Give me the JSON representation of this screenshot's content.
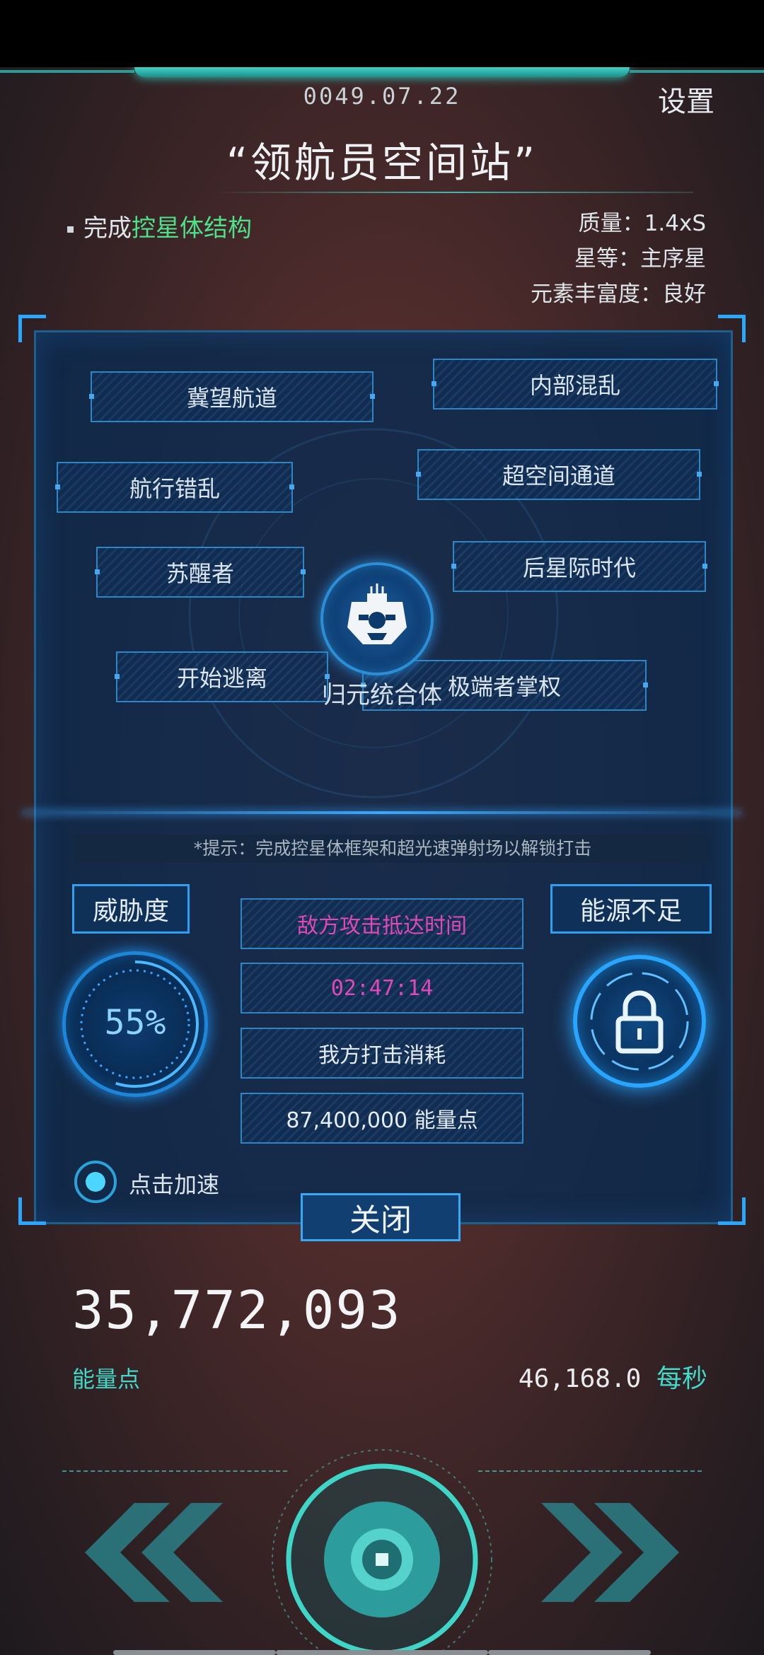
{
  "header": {
    "date": "0049.07.22",
    "settings_label": "设置",
    "title": "“领航员空间站”"
  },
  "task": {
    "prefix": "完成",
    "target": "控星体结构"
  },
  "stats": {
    "mass": "质量：1.4xS",
    "star_class": "星等：主序星",
    "element_richness": "元素丰富度：良好"
  },
  "tree": {
    "nodes": [
      "冀望航道",
      "内部混乱",
      "航行错乱",
      "超空间通道",
      "苏醒者",
      "后星际时代",
      "开始逃离",
      "极端者掌权"
    ],
    "center_label": "归元统合体"
  },
  "attack": {
    "hint": "*提示：完成控星体框架和超光速弹射场以解锁打击",
    "threat_label": "威胁度",
    "threat_value": "55%",
    "threat_fraction": 0.55,
    "energy_status": "能源不足",
    "enemy_arrival_label": "敌方攻击抵达时间",
    "enemy_arrival_time": "02:47:14",
    "strike_cost_label": "我方打击消耗",
    "strike_cost_value": "87,400,000 能量点",
    "close_label": "关闭",
    "speedup_label": "点击加速"
  },
  "resources": {
    "energy_points": "35,772,093",
    "energy_unit": "能量点",
    "rate_value": "46,168.0",
    "rate_unit": "每秒"
  },
  "colors": {
    "accent_blue": "#2fa0ef",
    "accent_teal": "#42d8c8",
    "green": "#4fe08a",
    "pink": "#e048b8"
  }
}
